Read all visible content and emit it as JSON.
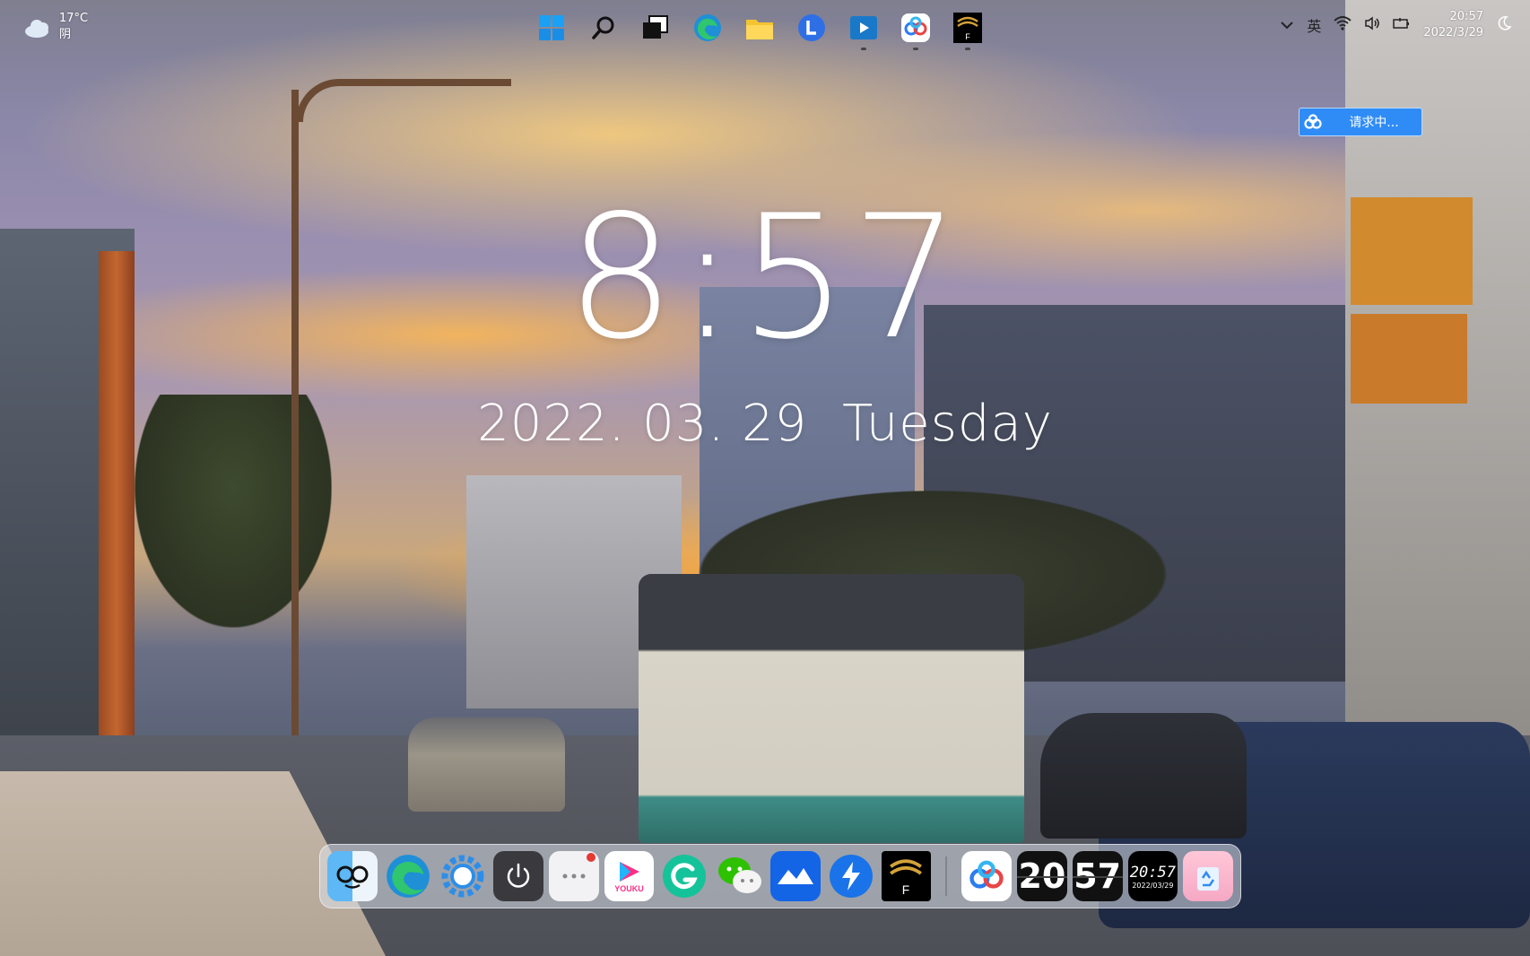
{
  "weather": {
    "temperature": "17°C",
    "condition": "阴"
  },
  "taskbar": {
    "icons": [
      "windows-start",
      "search",
      "task-view",
      "edge",
      "file-explorer",
      "lenovo-l",
      "video-player",
      "baidu-netdisk",
      "f-app"
    ]
  },
  "system_tray": {
    "chevron": "︿",
    "ime": "英",
    "time": "20:57",
    "date": "2022/3/29"
  },
  "request_popup": {
    "label": "请求中..."
  },
  "lock_clock": {
    "time": "8:57",
    "date": "2022. 03. 29",
    "weekday": "Tuesday"
  },
  "dock": {
    "apps": [
      "finder-face",
      "edge",
      "settings-gear",
      "power",
      "messages-dots",
      "youku",
      "grammarly-g",
      "wechat",
      "lark",
      "thunder",
      "f-app",
      "baidu-netdisk"
    ],
    "youku_label": "YOUKU",
    "flip_hour": "20",
    "flip_minute": "57",
    "mini_clock_time": "20:57",
    "mini_clock_date": "2022/03/29"
  },
  "colors": {
    "accent_blue": "#2f8cf6",
    "dock_bg": "rgba(220,225,235,0.55)"
  }
}
